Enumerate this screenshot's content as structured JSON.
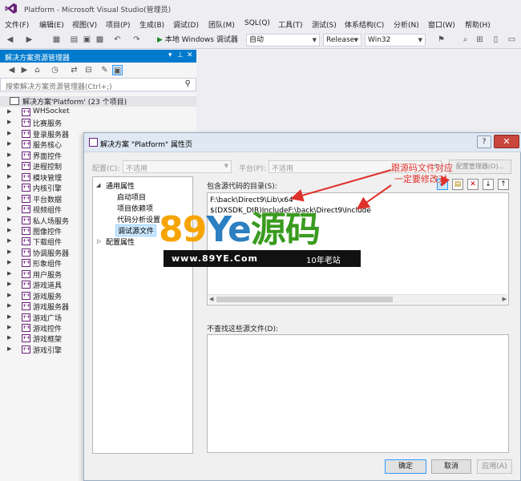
{
  "window": {
    "title": "Platform - Microsoft Visual Studio(管理员)"
  },
  "menu": [
    "文件(F)",
    "编辑(E)",
    "视图(V)",
    "项目(P)",
    "生成(B)",
    "调试(D)",
    "团队(M)",
    "SQL(Q)",
    "工具(T)",
    "测试(S)",
    "体系结构(C)",
    "分析(N)",
    "窗口(W)",
    "帮助(H)"
  ],
  "toolbar": {
    "start_label": "本地 Windows 调试器",
    "config_mode": "自动",
    "configuration": "Release",
    "platform": "Win32"
  },
  "solution_explorer": {
    "title": "解决方案资源管理器",
    "search_placeholder": "搜索解决方案资源管理器(Ctrl+;)",
    "solution_label": "解决方案'Platform' (23 个项目)",
    "projects": [
      "WHSocket",
      "比赛服务",
      "登录服务器",
      "服务核心",
      "界面控件",
      "进程控制",
      "模块管理",
      "内核引擎",
      "平台数据",
      "视频组件",
      "私人场服务",
      "图像控件",
      "下载组件",
      "协调服务器",
      "形象组件",
      "用户服务",
      "游戏道具",
      "游戏服务",
      "游戏服务器",
      "游戏广场",
      "游戏控件",
      "游戏框架",
      "游戏引擎"
    ]
  },
  "dialog": {
    "title": "解决方案 \"Platform\" 属性页",
    "config_label": "配置(C):",
    "config_value": "不适用",
    "platform_label": "平台(P):",
    "platform_value": "不适用",
    "config_manager": "配置管理器(O)...",
    "tree": {
      "common": "通用属性",
      "startup": "启动项目",
      "deps": "项目依赖项",
      "code_analysis": "代码分析设置",
      "debug_source": "调试源文件",
      "config_props": "配置属性"
    },
    "include_label": "包含源代码的目录(S):",
    "include_paths": [
      "F:\\back\\Direct9\\Lib\\x64",
      "$(DXSDK_DIR)IncludeF:\\back\\Direct9\\Include"
    ],
    "exclude_label": "不查找这些源文件(D):",
    "ok": "确定",
    "cancel": "取消",
    "apply": "应用(A)"
  },
  "annotation": {
    "line1": "跟源码文件对应",
    "line2": "一定要修改对",
    "color": "#e0312c"
  },
  "watermark": {
    "number": "89",
    "ye": "Ye",
    "chinese": "源码",
    "url": "www.89YE.Com",
    "slogan": "10年老站"
  }
}
